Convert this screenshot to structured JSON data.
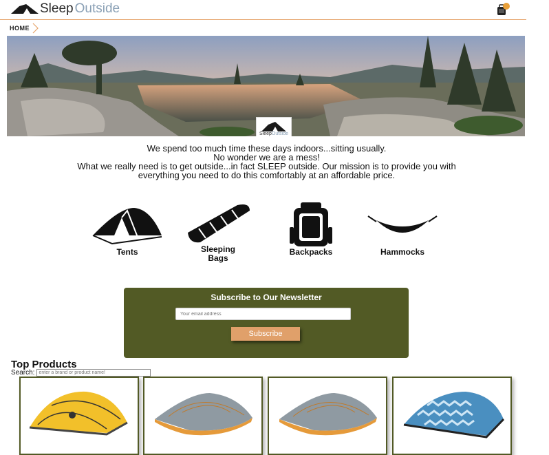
{
  "header": {
    "logo_sleep": "Sleep",
    "logo_outside": "Outside",
    "cart_icon": "backpack-cart-icon",
    "cart_badge_color": "#e8a03a"
  },
  "breadcrumb": {
    "label": "HOME"
  },
  "hero": {
    "logo_sleep": "Sleep",
    "logo_outside": "Outside"
  },
  "mission": {
    "lines": [
      "We spend too much time these days indoors...sitting usually.",
      "No wonder we are a mess!",
      "What we really need is to get outside...in fact SLEEP outside. Our mission is to provide you with everything you need to do this comfortably at an affordable price."
    ]
  },
  "categories": [
    {
      "label": "Tents",
      "icon": "tent-icon"
    },
    {
      "label": "Sleeping Bags",
      "icon": "sleeping-bag-icon"
    },
    {
      "label": "Backpacks",
      "icon": "backpack-icon"
    },
    {
      "label": "Hammocks",
      "icon": "hammock-icon"
    }
  ],
  "newsletter": {
    "title": "Subscribe to Our Newsletter",
    "email_placeholder": "Your email address",
    "button_label": "Subscribe",
    "background_color": "#525a25",
    "button_color": "#e0a06a"
  },
  "top_products": {
    "title": "Top Products",
    "search_label": "Search:",
    "search_placeholder": "enter a brand or product name!",
    "products": [
      {
        "image": "yellow-dome-tent"
      },
      {
        "image": "grey-orange-backpacking-tent"
      },
      {
        "image": "grey-orange-backpacking-tent"
      },
      {
        "image": "blue-wave-pattern-tent"
      }
    ]
  }
}
